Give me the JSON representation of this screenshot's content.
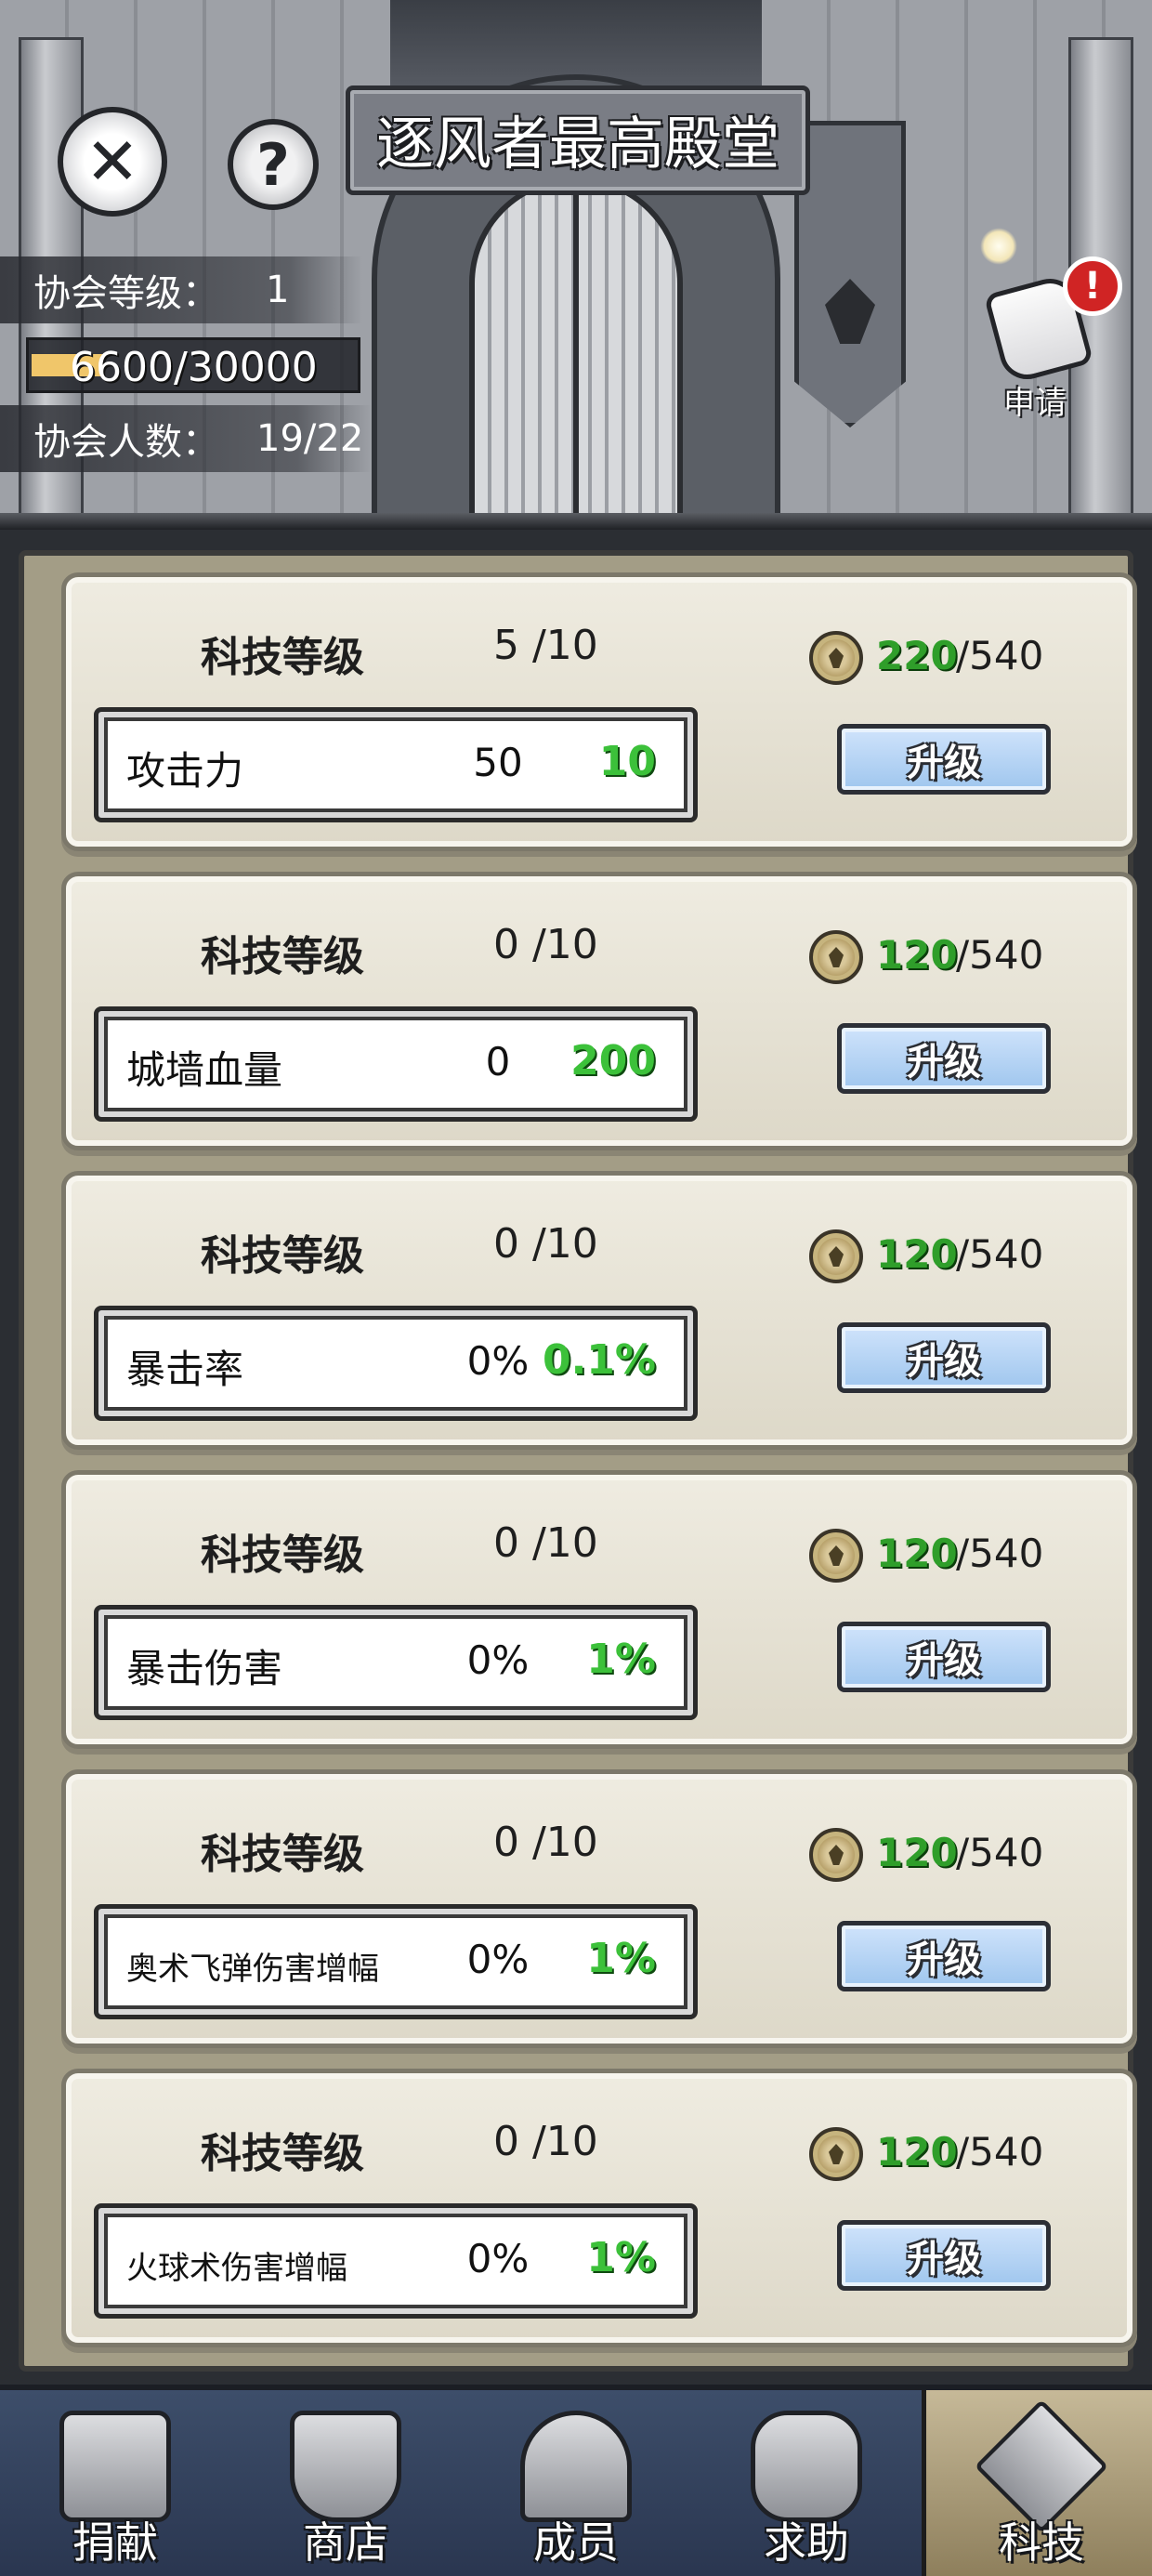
{
  "header": {
    "title": "逐风者最高殿堂",
    "close_icon": "close-x-icon",
    "help_icon": "question-mark-icon",
    "guild_level_label": "协会等级：",
    "guild_level_value": "1",
    "experience_text": "6600/30000",
    "experience_fraction": 0.22,
    "member_count_label": "协会人数：",
    "member_count_value": "19/22",
    "apply_label": "申请",
    "apply_alert": "!"
  },
  "tech_level_label": "科技等级",
  "upgrade_label": "升级",
  "tech_items": [
    {
      "name": "攻击力",
      "level": "5 /10",
      "current": "50",
      "increment": "10",
      "cost_have": "220",
      "cost_need": "/540"
    },
    {
      "name": "城墙血量",
      "level": "0 /10",
      "current": "0",
      "increment": "200",
      "cost_have": "120",
      "cost_need": "/540"
    },
    {
      "name": "暴击率",
      "level": "0 /10",
      "current": "0%",
      "increment": "0.1%",
      "cost_have": "120",
      "cost_need": "/540"
    },
    {
      "name": "暴击伤害",
      "level": "0 /10",
      "current": "0%",
      "increment": "1%",
      "cost_have": "120",
      "cost_need": "/540"
    },
    {
      "name": "奥术飞弹伤害增幅",
      "level": "0 /10",
      "current": "0%",
      "increment": "1%",
      "cost_have": "120",
      "cost_need": "/540"
    },
    {
      "name": "火球术伤害增幅",
      "level": "0 /10",
      "current": "0%",
      "increment": "1%",
      "cost_have": "120",
      "cost_need": "/540"
    }
  ],
  "bottom_nav": [
    {
      "label": "捐献",
      "icon": "donate-chest-icon"
    },
    {
      "label": "商店",
      "icon": "shop-icon"
    },
    {
      "label": "成员",
      "icon": "members-icon"
    },
    {
      "label": "求助",
      "icon": "help-fist-icon"
    },
    {
      "label": "科技",
      "icon": "tech-icon",
      "active": true
    }
  ],
  "colors": {
    "increment_green": "#3cc13a",
    "upgrade_button": "#9fc6ee",
    "panel_bg": "#a39d86",
    "nav_bg": "#2a3650"
  }
}
